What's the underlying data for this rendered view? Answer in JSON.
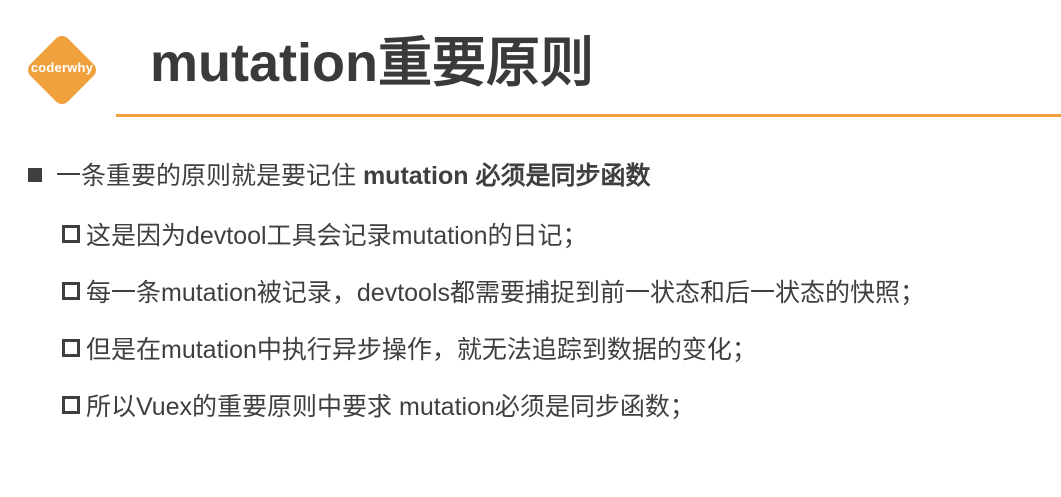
{
  "logo": {
    "text": "coderwhy",
    "color": "#f0a13e"
  },
  "header": {
    "title": "mutation重要原则",
    "rule_color": "#f0a13e"
  },
  "content": {
    "main_bullet": {
      "text_normal": "一条重要的原则就是要记住 ",
      "text_bold": "mutation 必须是同步函数"
    },
    "sub_bullets": [
      "这是因为devtool工具会记录mutation的日记；",
      "每一条mutation被记录，devtools都需要捕捉到前一状态和后一状态的快照；",
      "但是在mutation中执行异步操作，就无法追踪到数据的变化；",
      "所以Vuex的重要原则中要求 mutation必须是同步函数；"
    ]
  }
}
